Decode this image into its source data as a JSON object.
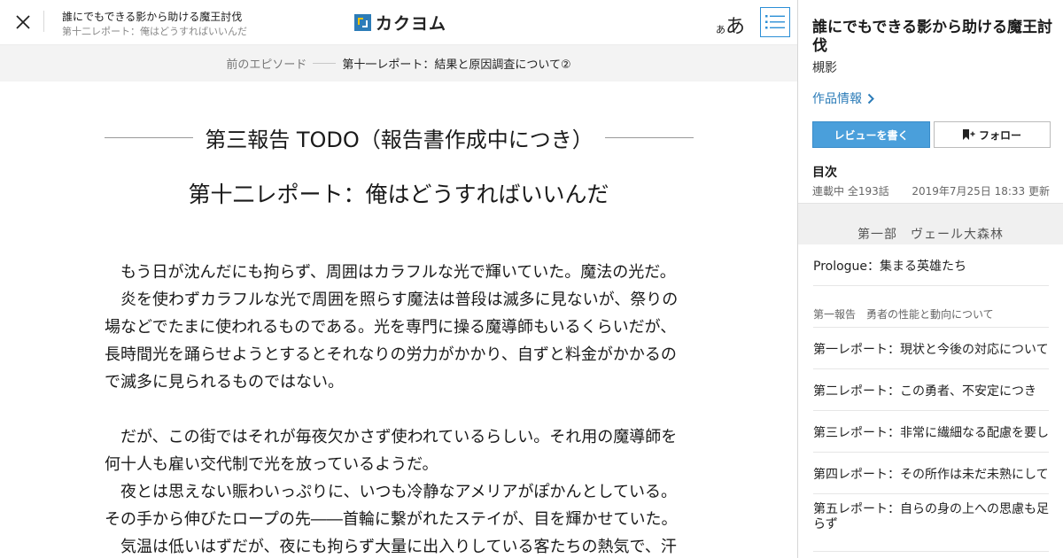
{
  "header": {
    "work_title": "誰にでもできる影から助ける魔王討伐",
    "episode_subtitle": "第十二レポート：俺はどうすればいいんだ",
    "logo_text": "カクヨム",
    "font_small": "あ",
    "font_large": "あ"
  },
  "episode_nav": {
    "prev_label": "前のエピソード",
    "prev_title": "第十一レポート：結果と原因調査について②"
  },
  "content": {
    "chapter_title": "第三報告 TODO（報告書作成中につき）",
    "episode_title": "第十二レポート：俺はどうすればいいんだ",
    "lines": [
      "　もう日が沈んだにも拘らず、周囲はカラフルな光で輝いていた。魔法の光だ。",
      "　炎を使わずカラフルな光で周囲を照らす魔法は普段は滅多に見ないが、祭りの",
      "場などでたまに使われるものである。光を専門に操る魔導師もいるくらいだが、",
      "長時間光を踊らせようとするとそれなりの労力がかかり、自ずと料金がかかるの",
      "で滅多に見られるものではない。",
      "",
      "　だが、この街ではそれが毎夜欠かさず使われているらしい。それ用の魔導師を",
      "何十人も雇い交代制で光を放っているようだ。",
      "　夜とは思えない賑わいっぷりに、いつも冷静なアメリアがぽかんとしている。",
      "その手から伸びたロープの先――首輪に繋がれたステイが、目を輝かせていた。",
      "　気温は低いはずだが、夜にも拘らず大量に出入りしている客たちの熱気で、汗"
    ]
  },
  "sidebar": {
    "title": "誰にでもできる影から助ける魔王討伐",
    "author": "槻影",
    "work_info": "作品情報",
    "review_button": "レビューを書く",
    "follow_button": "フォロー",
    "toc_label": "目次",
    "status": "連載中 全193話",
    "updated": "2019年7月25日 18:33 更新",
    "part_header": "第一部　ヴェール大森林",
    "prologue": "Prologue：集まる英雄たち",
    "section_title": "第一報告　勇者の性能と動向について",
    "episodes": [
      "第一レポート：現状と今後の対応について",
      "第二レポート：この勇者、不安定につき",
      "第三レポート：非常に繊細なる配慮を要し",
      "第四レポート：その所作は未だ未熟にして"
    ],
    "episode_tall_line1": "第五レポート：自らの身の上への思慮も足",
    "episode_tall_line2": "らず"
  }
}
